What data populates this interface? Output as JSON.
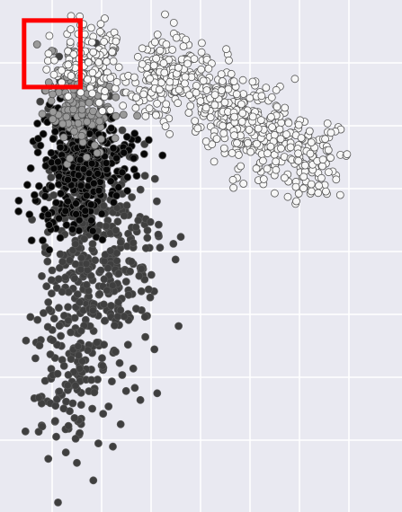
{
  "chart_data": {
    "type": "scatter",
    "title": "",
    "xlabel": "",
    "ylabel": "",
    "xlim": [
      0,
      10
    ],
    "ylim": [
      0,
      10
    ],
    "grid": true,
    "tick_labels_visible": false,
    "legend": "none",
    "background_color": "#e9e9f1",
    "grid_color": "#ffffff",
    "point_edge_color": "#555555",
    "highlight": {
      "shape": "rectangle",
      "color": "#ff0000",
      "x_range": [
        0.6,
        2.0
      ],
      "y_range": [
        8.3,
        9.6
      ]
    },
    "series": [
      {
        "fill_color": "#3f3f3f",
        "clusters": [
          {
            "cx": 2.1,
            "cy": 4.9,
            "sx": 0.55,
            "sy": 1.7,
            "n": 380
          },
          {
            "cx": 3.1,
            "cy": 5.2,
            "sx": 0.55,
            "sy": 0.9,
            "n": 120
          },
          {
            "cx": 1.5,
            "cy": 2.8,
            "sx": 0.35,
            "sy": 0.8,
            "n": 70
          }
        ]
      },
      {
        "fill_color": "#060606",
        "clusters": [
          {
            "cx": 1.8,
            "cy": 6.6,
            "sx": 0.5,
            "sy": 0.65,
            "n": 260
          },
          {
            "cx": 2.6,
            "cy": 6.9,
            "sx": 0.5,
            "sy": 0.5,
            "n": 80
          }
        ]
      },
      {
        "fill_color": "#9a9a9a",
        "clusters": [
          {
            "cx": 1.9,
            "cy": 8.1,
            "sx": 0.35,
            "sy": 0.45,
            "n": 130
          },
          {
            "cx": 2.4,
            "cy": 7.8,
            "sx": 0.5,
            "sy": 0.4,
            "n": 60
          }
        ]
      },
      {
        "fill_color": "#f7f7f7",
        "clusters": [
          {
            "cx": 2.2,
            "cy": 8.85,
            "sx": 0.45,
            "sy": 0.35,
            "n": 130
          },
          {
            "cx": 4.2,
            "cy": 8.55,
            "sx": 0.55,
            "sy": 0.35,
            "n": 210
          },
          {
            "cx": 5.6,
            "cy": 7.9,
            "sx": 0.5,
            "sy": 0.38,
            "n": 170
          },
          {
            "cx": 6.7,
            "cy": 7.2,
            "sx": 0.5,
            "sy": 0.38,
            "n": 140
          },
          {
            "cx": 7.8,
            "cy": 6.8,
            "sx": 0.45,
            "sy": 0.3,
            "n": 90
          }
        ]
      }
    ]
  }
}
